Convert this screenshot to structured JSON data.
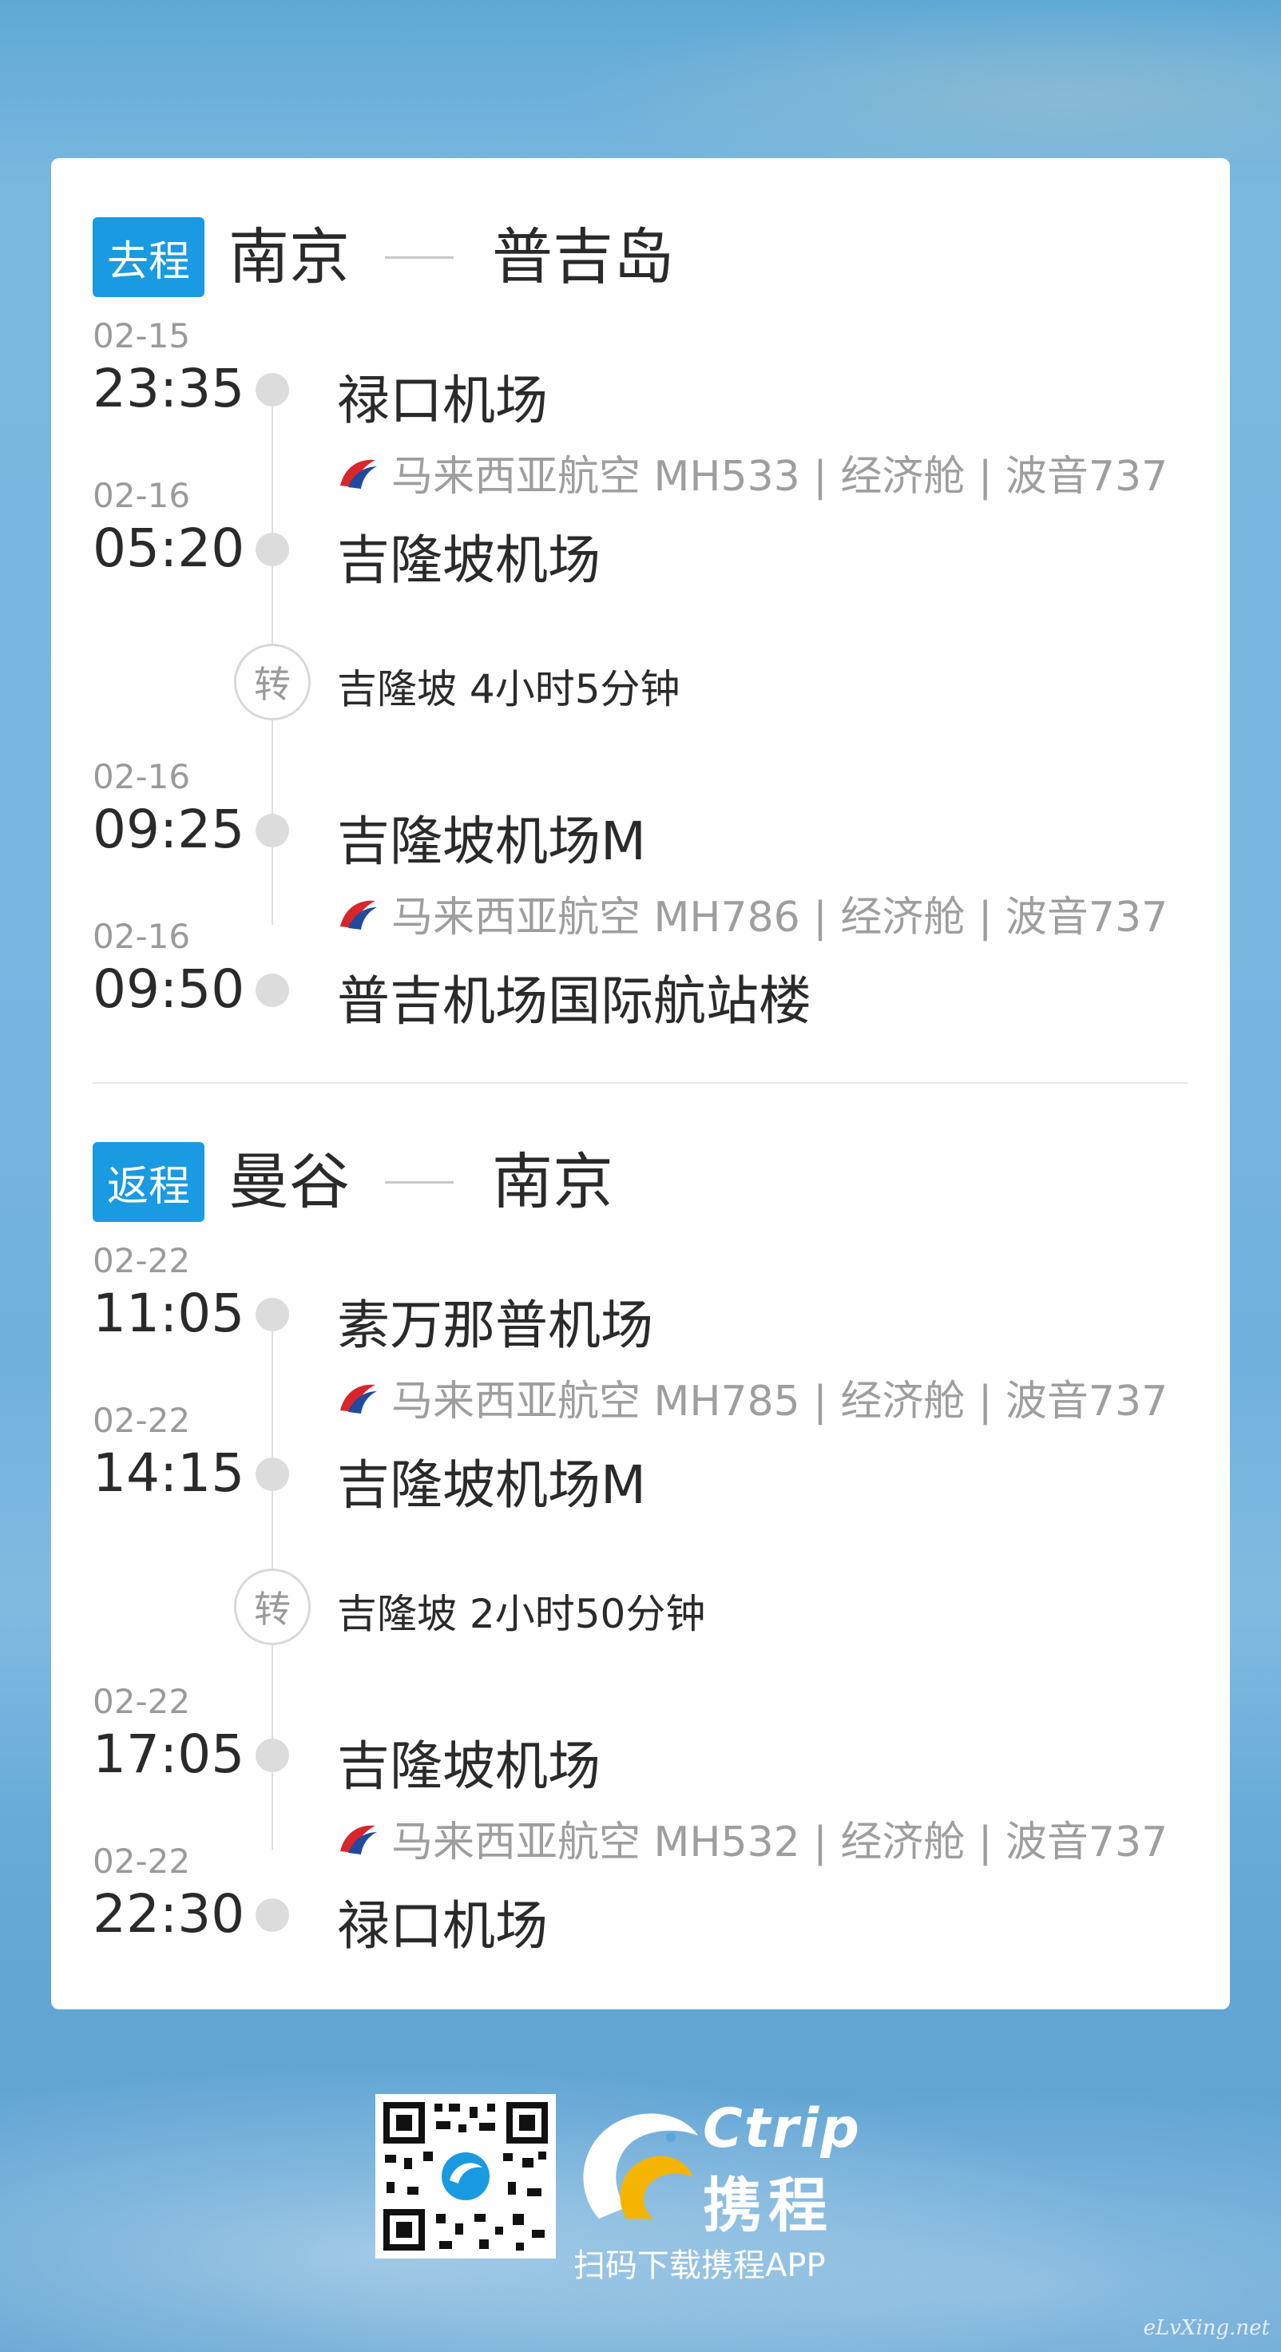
{
  "outbound": {
    "badge": "去程",
    "from": "南京",
    "to": "普吉岛",
    "segments": [
      {
        "date": "02-15",
        "time": "23:35",
        "airport": "禄口机场"
      },
      {
        "flight": "马来西亚航空 MH533 | 经济舱 | 波音737"
      },
      {
        "date": "02-16",
        "time": "05:20",
        "airport": "吉隆坡机场"
      },
      {
        "transfer_icon": "转",
        "transfer_text": "吉隆坡 4小时5分钟"
      },
      {
        "date": "02-16",
        "time": "09:25",
        "airport": "吉隆坡机场M"
      },
      {
        "flight": "马来西亚航空 MH786 | 经济舱 | 波音737"
      },
      {
        "date": "02-16",
        "time": "09:50",
        "airport": "普吉机场国际航站楼"
      }
    ]
  },
  "return": {
    "badge": "返程",
    "from": "曼谷",
    "to": "南京",
    "segments": [
      {
        "date": "02-22",
        "time": "11:05",
        "airport": "素万那普机场"
      },
      {
        "flight": "马来西亚航空 MH785 | 经济舱 | 波音737"
      },
      {
        "date": "02-22",
        "time": "14:15",
        "airport": "吉隆坡机场M"
      },
      {
        "transfer_icon": "转",
        "transfer_text": "吉隆坡 2小时50分钟"
      },
      {
        "date": "02-22",
        "time": "17:05",
        "airport": "吉隆坡机场"
      },
      {
        "flight": "马来西亚航空 MH532 | 经济舱 | 波音737"
      },
      {
        "date": "02-22",
        "time": "22:30",
        "airport": "禄口机场"
      }
    ]
  },
  "footer": {
    "brand_name": "Ctrip",
    "brand_cn": "携程",
    "tagline": "扫码下载携程APP",
    "qr_icon": "qr-code-icon",
    "logo_icon": "dolphin-logo-icon"
  },
  "watermark": "eLvXing.net",
  "colors": {
    "badge": "#1a9ae0",
    "airline_red": "#d8262c",
    "airline_blue": "#1f4aa0"
  }
}
